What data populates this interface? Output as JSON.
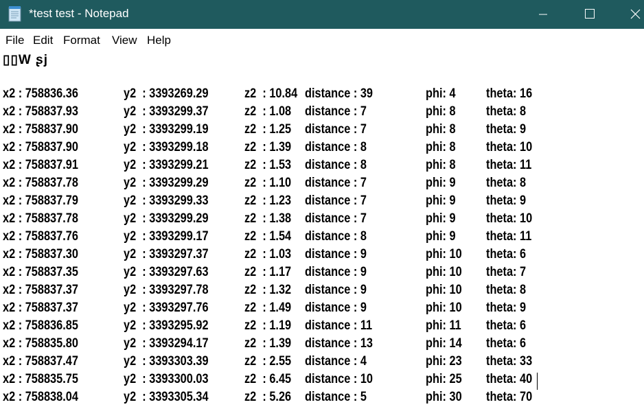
{
  "window": {
    "title": "*test test - Notepad",
    "title_bar_color": "#1f5a5e",
    "icons": {
      "app": "notepad-icon",
      "minimize": "minimize-icon",
      "maximize": "maximize-icon",
      "close": "close-icon"
    }
  },
  "menu": [
    "File",
    "Edit",
    "Format",
    "View",
    "Help"
  ],
  "editor": {
    "first_line": "▯▯W ʂj",
    "rows": [
      {
        "x2": "x2 : 758836.36",
        "y2": "y2  : 3393269.29",
        "z2": "z2  : 10.84",
        "distance": "distance : 39",
        "phi": "phi: 4",
        "theta": "theta: 16"
      },
      {
        "x2": "x2 : 758837.93",
        "y2": "y2  : 3393299.37",
        "z2": "z2  : 1.08",
        "distance": "distance : 7",
        "phi": "phi: 8",
        "theta": "theta: 8"
      },
      {
        "x2": "x2 : 758837.90",
        "y2": "y2  : 3393299.19",
        "z2": "z2  : 1.25",
        "distance": "distance : 7",
        "phi": "phi: 8",
        "theta": "theta: 9"
      },
      {
        "x2": "x2 : 758837.90",
        "y2": "y2  : 3393299.18",
        "z2": "z2  : 1.39",
        "distance": "distance : 8",
        "phi": "phi: 8",
        "theta": "theta: 10"
      },
      {
        "x2": "x2 : 758837.91",
        "y2": "y2  : 3393299.21",
        "z2": "z2  : 1.53",
        "distance": "distance : 8",
        "phi": "phi: 8",
        "theta": "theta: 11"
      },
      {
        "x2": "x2 : 758837.78",
        "y2": "y2  : 3393299.29",
        "z2": "z2  : 1.10",
        "distance": "distance : 7",
        "phi": "phi: 9",
        "theta": "theta: 8"
      },
      {
        "x2": "x2 : 758837.79",
        "y2": "y2  : 3393299.33",
        "z2": "z2  : 1.23",
        "distance": "distance : 7",
        "phi": "phi: 9",
        "theta": "theta: 9"
      },
      {
        "x2": "x2 : 758837.78",
        "y2": "y2  : 3393299.29",
        "z2": "z2  : 1.38",
        "distance": "distance : 7",
        "phi": "phi: 9",
        "theta": "theta: 10"
      },
      {
        "x2": "x2 : 758837.76",
        "y2": "y2  : 3393299.17",
        "z2": "z2  : 1.54",
        "distance": "distance : 8",
        "phi": "phi: 9",
        "theta": "theta: 11"
      },
      {
        "x2": "x2 : 758837.30",
        "y2": "y2  : 3393297.37",
        "z2": "z2  : 1.03",
        "distance": "distance : 9",
        "phi": "phi: 10",
        "theta": "theta: 6"
      },
      {
        "x2": "x2 : 758837.35",
        "y2": "y2  : 3393297.63",
        "z2": "z2  : 1.17",
        "distance": "distance : 9",
        "phi": "phi: 10",
        "theta": "theta: 7"
      },
      {
        "x2": "x2 : 758837.37",
        "y2": "y2  : 3393297.78",
        "z2": "z2  : 1.32",
        "distance": "distance : 9",
        "phi": "phi: 10",
        "theta": "theta: 8"
      },
      {
        "x2": "x2 : 758837.37",
        "y2": "y2  : 3393297.76",
        "z2": "z2  : 1.49",
        "distance": "distance : 9",
        "phi": "phi: 10",
        "theta": "theta: 9"
      },
      {
        "x2": "x2 : 758836.85",
        "y2": "y2  : 3393295.92",
        "z2": "z2  : 1.19",
        "distance": "distance : 11",
        "phi": "phi: 11",
        "theta": "theta: 6"
      },
      {
        "x2": "x2 : 758835.80",
        "y2": "y2  : 3393294.17",
        "z2": "z2  : 1.39",
        "distance": "distance : 13",
        "phi": "phi: 14",
        "theta": "theta: 6"
      },
      {
        "x2": "x2 : 758837.47",
        "y2": "y2  : 3393303.39",
        "z2": "z2  : 2.55",
        "distance": "distance : 4",
        "phi": "phi: 23",
        "theta": "theta: 33"
      },
      {
        "x2": "x2 : 758835.75",
        "y2": "y2  : 3393300.03",
        "z2": "z2  : 6.45",
        "distance": "distance : 10",
        "phi": "phi: 25",
        "theta": "theta: 40"
      },
      {
        "x2": "x2 : 758838.04",
        "y2": "y2  : 3393305.34",
        "z2": "z2  : 5.26",
        "distance": "distance : 5",
        "phi": "phi: 30",
        "theta": "theta: 70"
      }
    ]
  }
}
